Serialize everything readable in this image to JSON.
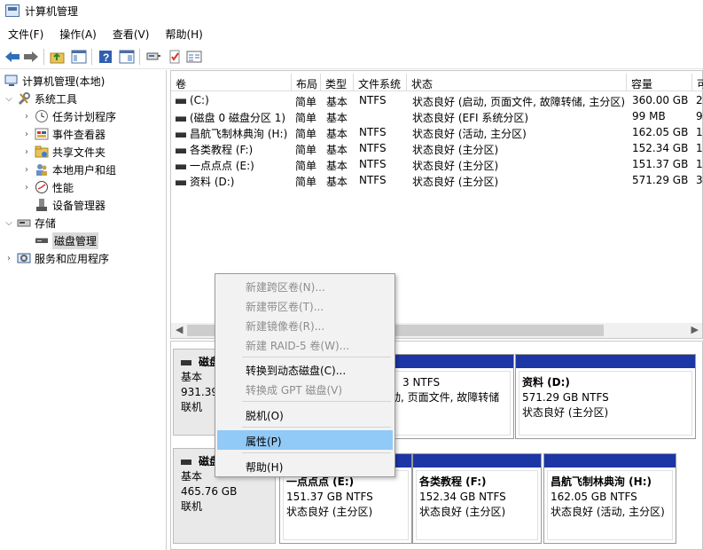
{
  "window": {
    "title": "计算机管理"
  },
  "menu": {
    "items": [
      "文件(F)",
      "操作(A)",
      "查看(V)",
      "帮助(H)"
    ]
  },
  "toolbar": {
    "icons": [
      "back-arrow-icon",
      "forward-arrow-icon",
      "up-folder-icon",
      "show-hide-tree-icon",
      "help-icon",
      "console-icon",
      "connect-icon",
      "check-icon",
      "properties-icon"
    ]
  },
  "tree": {
    "root": "计算机管理(本地)",
    "system_tools": "系统工具",
    "task_scheduler": "任务计划程序",
    "event_viewer": "事件查看器",
    "shared_folders": "共享文件夹",
    "local_users": "本地用户和组",
    "performance": "性能",
    "device_manager": "设备管理器",
    "storage": "存储",
    "disk_management": "磁盘管理",
    "services_apps": "服务和应用程序"
  },
  "volumes": {
    "columns": [
      "卷",
      "布局",
      "类型",
      "文件系统",
      "状态",
      "容量",
      "可"
    ],
    "rows": [
      {
        "vol": "(C:)",
        "layout": "简单",
        "type": "基本",
        "fs": "NTFS",
        "status": "状态良好 (启动, 页面文件, 故障转储, 主分区)",
        "capacity": "360.00 GB",
        "free": "2"
      },
      {
        "vol": "(磁盘 0 磁盘分区 1)",
        "layout": "简单",
        "type": "基本",
        "fs": "",
        "status": "状态良好 (EFI 系统分区)",
        "capacity": "99 MB",
        "free": "9"
      },
      {
        "vol": "昌航飞制林典洵 (H:)",
        "layout": "简单",
        "type": "基本",
        "fs": "NTFS",
        "status": "状态良好 (活动, 主分区)",
        "capacity": "162.05 GB",
        "free": "1"
      },
      {
        "vol": "各类教程 (F:)",
        "layout": "简单",
        "type": "基本",
        "fs": "NTFS",
        "status": "状态良好 (主分区)",
        "capacity": "152.34 GB",
        "free": "1"
      },
      {
        "vol": "一点点点 (E:)",
        "layout": "简单",
        "type": "基本",
        "fs": "NTFS",
        "status": "状态良好 (主分区)",
        "capacity": "151.37 GB",
        "free": "1"
      },
      {
        "vol": "资料 (D:)",
        "layout": "简单",
        "type": "基本",
        "fs": "NTFS",
        "status": "状态良好 (主分区)",
        "capacity": "571.29 GB",
        "free": "3"
      }
    ]
  },
  "disk0": {
    "name": "磁盘",
    "type": "基本",
    "size": "931.39",
    "status": "联机",
    "partitions": [
      {
        "text": "3 NTFS",
        "text2": "启动, 页面文件, 故障转储"
      },
      {
        "name": "资料 (D:)",
        "size": "571.29 GB NTFS",
        "status": "状态良好 (主分区)"
      }
    ]
  },
  "disk1": {
    "name": "磁盘",
    "type": "基本",
    "size": "465.76 GB",
    "status": "联机",
    "partitions": [
      {
        "name": "一点点点 (E:)",
        "size": "151.37 GB NTFS",
        "status": "状态良好 (主分区)"
      },
      {
        "name": "各类教程 (F:)",
        "size": "152.34 GB NTFS",
        "status": "状态良好 (主分区)"
      },
      {
        "name": "昌航飞制林典洵 (H:)",
        "size": "162.05 GB NTFS",
        "status": "状态良好 (活动, 主分区)"
      }
    ]
  },
  "context_menu": {
    "spanned": "新建跨区卷(N)...",
    "striped": "新建带区卷(T)...",
    "mirrored": "新建镜像卷(R)...",
    "raid5": "新建 RAID-5 卷(W)...",
    "convert_dynamic": "转换到动态磁盘(C)...",
    "convert_gpt": "转换成 GPT 磁盘(V)",
    "offline": "脱机(O)",
    "properties": "属性(P)",
    "help": "帮助(H)"
  }
}
